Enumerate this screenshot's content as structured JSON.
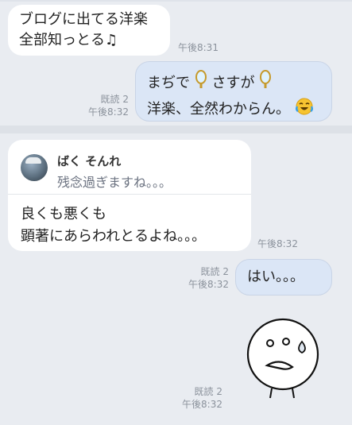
{
  "messages": {
    "m1": {
      "lines": [
        "ブログに出てる洋楽",
        "全部知っとる♫"
      ],
      "time": "午後8:31"
    },
    "m2": {
      "line1_a": "まぢで",
      "line1_b": "さすが",
      "line2": "洋楽、全然わからん。",
      "read": "既読 2",
      "time": "午後8:32"
    },
    "m3": {
      "quote_name": "ばく そんれ",
      "quote_text": "残念過ぎますね。。。",
      "lines": [
        "良くも悪くも",
        "顕著にあらわれとるよね。。。"
      ],
      "time": "午後8:32"
    },
    "m4": {
      "text": "はい。。。",
      "read": "既読 2",
      "time": "午後8:32"
    },
    "m5": {
      "sticker": "sad-sweating-face-sticker",
      "read": "既読 2",
      "time": "午後8:32"
    }
  },
  "colors": {
    "background": "#e9ecf1",
    "incoming_bubble": "#ffffff",
    "outgoing_bubble": "#dbe6f6",
    "meta_text": "#8b929c"
  }
}
